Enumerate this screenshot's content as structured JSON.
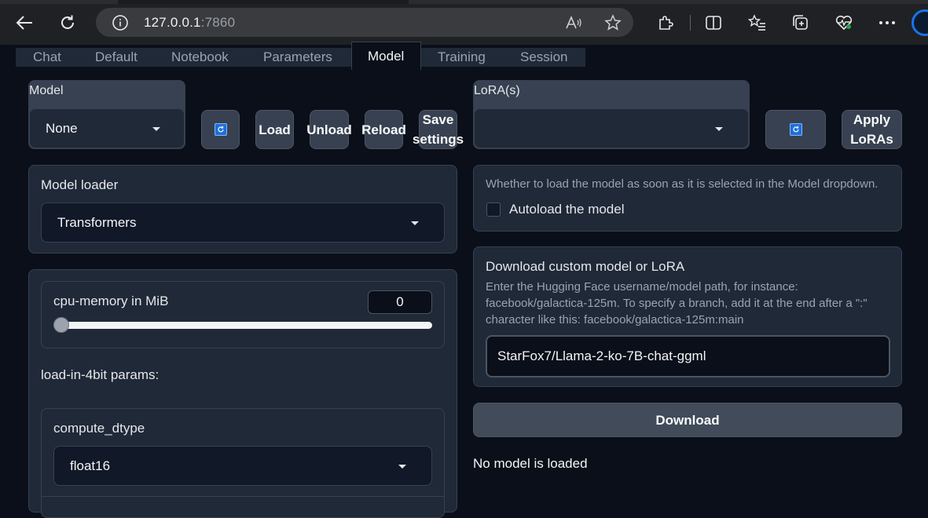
{
  "browser": {
    "url_host": "127.0.0.1",
    "url_port": ":7860"
  },
  "tabs": [
    {
      "label": "Chat",
      "active": false
    },
    {
      "label": "Default",
      "active": false
    },
    {
      "label": "Notebook",
      "active": false
    },
    {
      "label": "Parameters",
      "active": false
    },
    {
      "label": "Model",
      "active": true
    },
    {
      "label": "Training",
      "active": false
    },
    {
      "label": "Session",
      "active": false
    }
  ],
  "model": {
    "label": "Model",
    "selected": "None",
    "buttons": {
      "load": "Load",
      "unload": "Unload",
      "reload": "Reload",
      "save_line1": "Save",
      "save_line2": "settings"
    }
  },
  "lora": {
    "label": "LoRA(s)",
    "selected": "",
    "apply_line1": "Apply",
    "apply_line2": "LoRAs"
  },
  "loader": {
    "label": "Model loader",
    "selected": "Transformers"
  },
  "cpu_memory": {
    "label": "cpu-memory in MiB",
    "value": "0",
    "slider_fraction": 0
  },
  "load_4bit": {
    "label": "load-in-4bit params:"
  },
  "compute_dtype": {
    "label": "compute_dtype",
    "selected": "float16"
  },
  "autoload": {
    "help": "Whether to load the model as soon as it is selected in the Model dropdown.",
    "label": "Autoload the model",
    "checked": false
  },
  "download": {
    "title": "Download custom model or LoRA",
    "help_line1": "Enter the Hugging Face username/model path, for instance:",
    "help_line2": "facebook/galactica-125m. To specify a branch, add it at the end after a \":\"",
    "help_line3": "character like this: facebook/galactica-125m:main",
    "value": "StarFox7/Llama-2-ko-7B-chat-ggml",
    "button": "Download"
  },
  "status": "No model is loaded",
  "colors": {
    "background": "#0b0f19",
    "panel": "#1f2937",
    "border": "#374151",
    "button": "#374151",
    "accent": "#1e6fd9"
  }
}
